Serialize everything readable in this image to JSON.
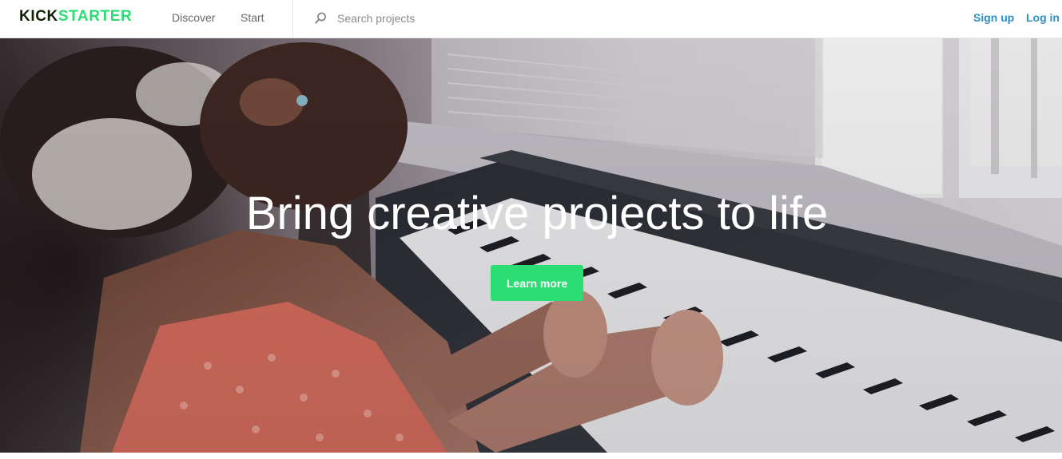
{
  "header": {
    "logo_part1": "KICK",
    "logo_part2": "STARTER",
    "nav": {
      "discover_label": "Discover",
      "start_label": "Start"
    },
    "search": {
      "placeholder": "Search projects",
      "value": "",
      "icon": "search-icon"
    },
    "auth": {
      "signup_label": "Sign up",
      "login_label": "Log in"
    }
  },
  "hero": {
    "title": "Bring creative projects to life",
    "button_label": "Learn more",
    "image_description_icon": "hero-photo"
  },
  "colors": {
    "brand_green": "#2bde73",
    "brand_dark": "#0f2105",
    "link_blue": "#2d8fca",
    "nav_gray": "#656969"
  }
}
